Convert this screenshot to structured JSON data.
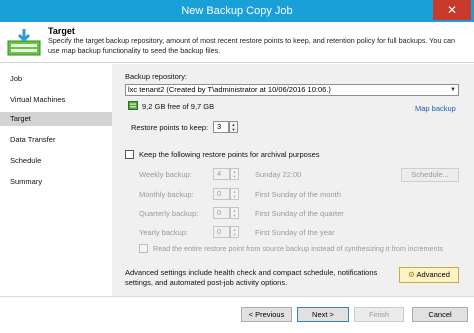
{
  "window": {
    "title": "New Backup Copy Job",
    "close_glyph": "✕"
  },
  "header": {
    "title": "Target",
    "description": "Specify the target backup repository, amount of most recent restore points to keep, and retention policy for full backups. You can use map backup functionality to seed the backup files.",
    "icon": "target-backup-icon"
  },
  "sidebar": {
    "items": [
      {
        "label": "Job",
        "active": false
      },
      {
        "label": "Virtual Machines",
        "active": false
      },
      {
        "label": "Target",
        "active": true
      },
      {
        "label": "Data Transfer",
        "active": false
      },
      {
        "label": "Schedule",
        "active": false
      },
      {
        "label": "Summary",
        "active": false
      }
    ]
  },
  "target": {
    "repository_label": "Backup repository:",
    "repository_value": "lxc tenant2 (Created by T\\administrator at 10/06/2016 10:06.)",
    "free_space": "9,2 GB free of 9,7 GB",
    "map_backup_link": "Map backup",
    "restore_points_label": "Restore points to keep:",
    "restore_points_value": "3",
    "archival_checkbox_label": "Keep the following restore points for archival purposes",
    "archival": [
      {
        "label": "Weekly backup:",
        "value": "4",
        "schedule": "Sunday 22:00"
      },
      {
        "label": "Monthly backup:",
        "value": "0",
        "schedule": "First Sunday of the month"
      },
      {
        "label": "Quarterly backup:",
        "value": "0",
        "schedule": "First Sunday of the quarter"
      },
      {
        "label": "Yearly backup:",
        "value": "0",
        "schedule": "First Sunday of the year"
      }
    ],
    "schedule_button": "Schedule...",
    "read_entire_label": "Read the entire restore point from source backup instead of synthesizing it from increments",
    "advanced_text": "Advanced settings include health check and compact schedule, notifications settings, and automated post-job activity options.",
    "advanced_button": "Advanced"
  },
  "footer": {
    "previous": "< Previous",
    "next": "Next >",
    "finish": "Finish",
    "cancel": "Cancel"
  }
}
